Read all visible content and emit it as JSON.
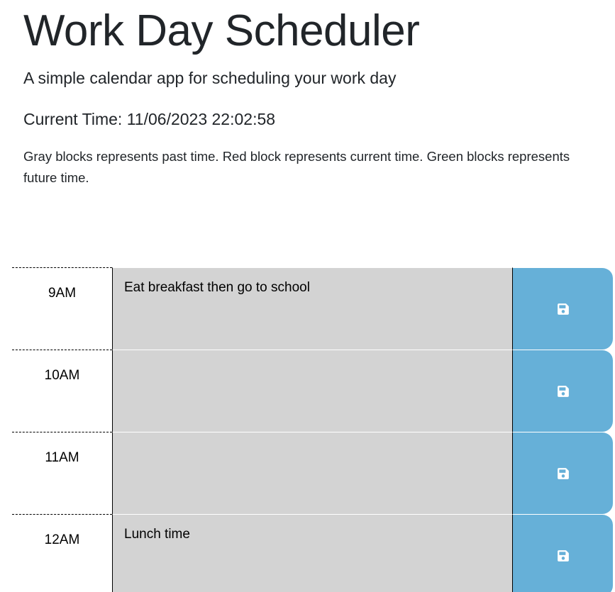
{
  "header": {
    "title": "Work Day Scheduler",
    "subtitle": "A simple calendar app for scheduling your work day",
    "current_time_label": "Current Time:",
    "current_time_value": "11/06/2023 22:02:58",
    "legend": "Gray blocks represents past time. Red block represents current time. Green blocks represents future time."
  },
  "schedule": {
    "rows": [
      {
        "hour": "9AM",
        "text": "Eat breakfast then go to school",
        "state": "past"
      },
      {
        "hour": "10AM",
        "text": "",
        "state": "past"
      },
      {
        "hour": "11AM",
        "text": "",
        "state": "past"
      },
      {
        "hour": "12AM",
        "text": "Lunch time",
        "state": "past"
      }
    ]
  },
  "colors": {
    "past": "#d3d3d3",
    "save_button": "#66b0d8",
    "save_icon": "#ffffff"
  },
  "icons": {
    "save": "floppy-disk-icon"
  }
}
